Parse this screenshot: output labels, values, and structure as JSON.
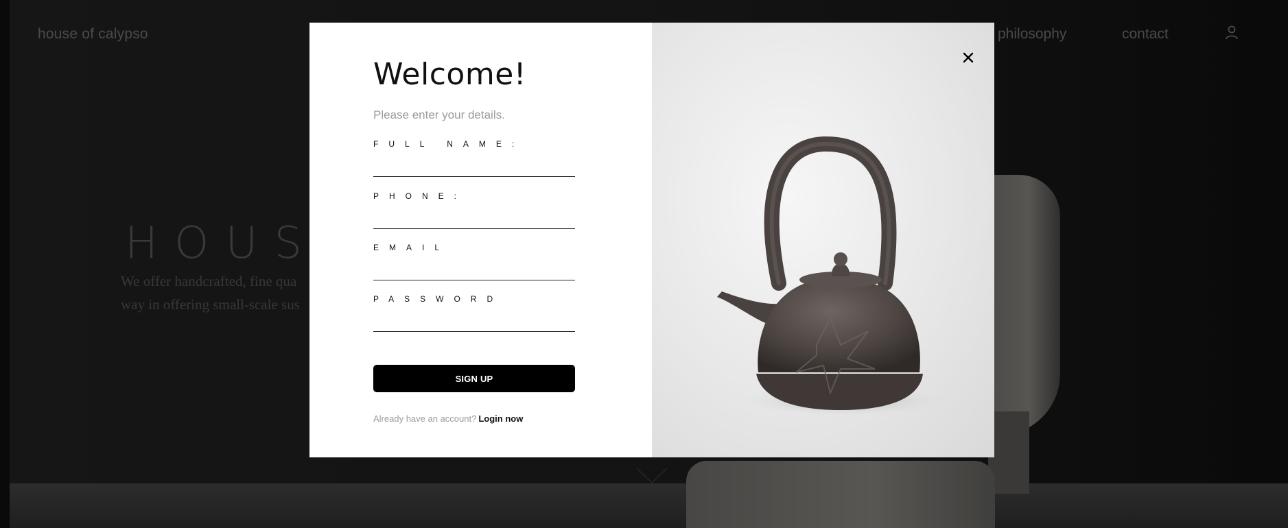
{
  "site": {
    "logo": "house of calypso",
    "nav": {
      "philosophy": "philosophy",
      "contact": "contact"
    },
    "hero": {
      "title": "HOUSE",
      "text_line_1": "We offer handcrafted, fine qua",
      "text_line_2": "way in offering small-scale sus"
    }
  },
  "modal": {
    "title": "Welcome!",
    "subtitle": "Please enter your details.",
    "fields": [
      {
        "label": "FULL NAME:",
        "value": ""
      },
      {
        "label": "PHONE:",
        "value": ""
      },
      {
        "label": "EMAIL",
        "value": ""
      },
      {
        "label": "PASSWORD",
        "value": ""
      }
    ],
    "submit_label": "SIGN UP",
    "login_prompt": "Already have an account?",
    "login_link": "Login now",
    "close_icon": "close-icon",
    "image_subject": "teapot-image"
  },
  "icons": {
    "user": "user-icon",
    "close": "close-icon",
    "scroll": "chevron-down-icon"
  },
  "colors": {
    "modal_bg": "#ffffff",
    "button_bg": "#000000",
    "button_text": "#ffffff",
    "muted_text": "#9b9b9b",
    "overlay": "rgba(0,0,0,0.48)"
  }
}
